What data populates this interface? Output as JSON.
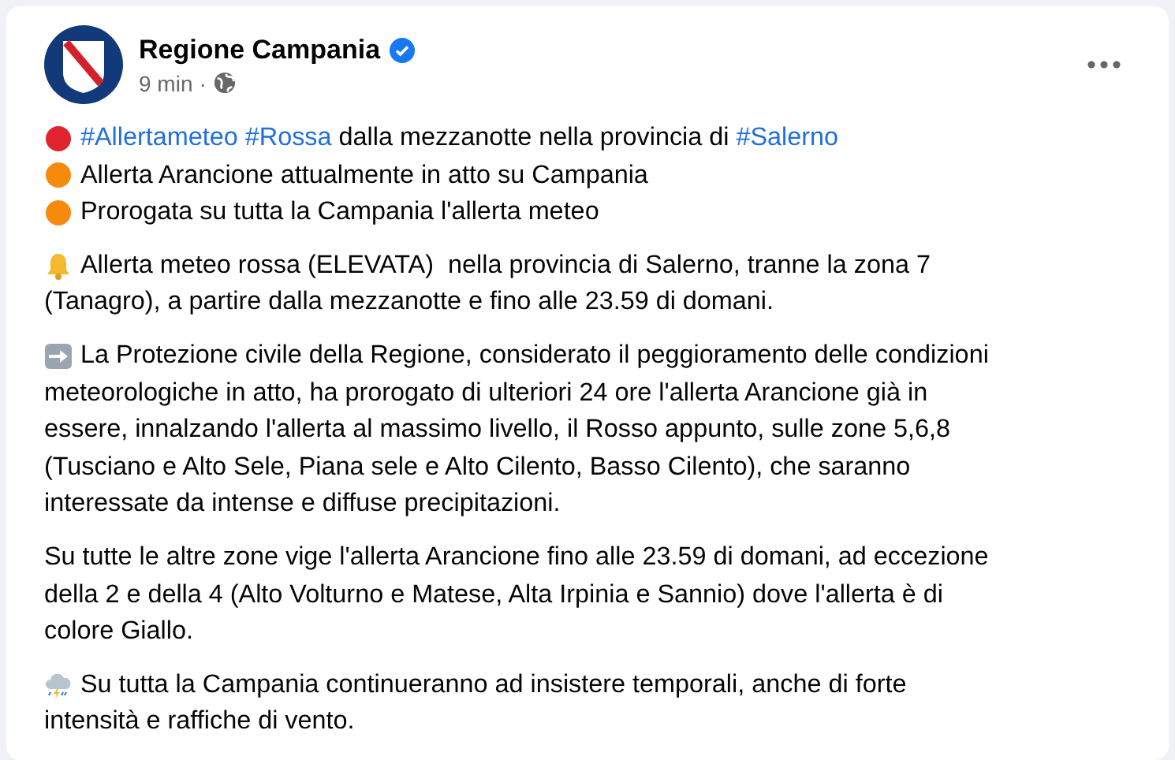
{
  "post": {
    "author": "Regione Campania",
    "verified": true,
    "time": "9 min",
    "separator": "·"
  },
  "paragraphs": [
    {
      "lines": [
        {
          "kind": "red-alert",
          "segments": [
            {
              "kind": "hashtag",
              "text": "#Allertameteo"
            },
            {
              "kind": "hashtag",
              "text": "#Rossa"
            },
            {
              "kind": "text",
              "text": " dalla mezzanotte nella provincia di "
            },
            {
              "kind": "hashtag",
              "text": "#Salerno"
            }
          ]
        },
        {
          "kind": "orange-alert",
          "segments": [
            {
              "kind": "text",
              "text": "Allerta Arancione attualmente in atto su Campania"
            }
          ]
        },
        {
          "kind": "orange-alert",
          "segments": [
            {
              "kind": "text",
              "text": "Prorogata su tutta la Campania l'allerta meteo"
            }
          ]
        }
      ]
    },
    {
      "lines": [
        {
          "kind": "bell",
          "segments": [
            {
              "kind": "text",
              "text": "Allerta meteo rossa (ELEVATA)  nella provincia di Salerno, tranne la zona 7"
            }
          ]
        },
        {
          "segments": [
            {
              "kind": "text",
              "text": "(Tanagro), a partire dalla mezzanotte e fino alle 23.59 di domani."
            }
          ]
        }
      ]
    },
    {
      "lines": [
        {
          "kind": "arrow",
          "segments": [
            {
              "kind": "text",
              "text": "La Protezione civile della Regione, considerato il peggioramento delle condizioni"
            }
          ]
        },
        {
          "segments": [
            {
              "kind": "text",
              "text": "meteorologiche in atto, ha prorogato di ulteriori 24 ore l'allerta Arancione già in"
            }
          ]
        },
        {
          "segments": [
            {
              "kind": "text",
              "text": "essere, innalzando l'allerta al massimo livello, il Rosso appunto, sulle zone 5,6,8"
            }
          ]
        },
        {
          "segments": [
            {
              "kind": "text",
              "text": "(Tusciano e Alto Sele, Piana sele e Alto Cilento, Basso Cilento), che saranno"
            }
          ]
        },
        {
          "segments": [
            {
              "kind": "text",
              "text": "interessate da intense e diffuse precipitazioni."
            }
          ]
        }
      ]
    },
    {
      "lines": [
        {
          "segments": [
            {
              "kind": "text",
              "text": "Su tutte le altre zone vige l'allerta Arancione fino alle 23.59 di domani, ad eccezione"
            }
          ]
        },
        {
          "segments": [
            {
              "kind": "text",
              "text": "della 2 e della 4 (Alto Volturno e Matese, Alta Irpinia e Sannio) dove l'allerta è di"
            }
          ]
        },
        {
          "segments": [
            {
              "kind": "text",
              "text": "colore Giallo."
            }
          ]
        }
      ]
    },
    {
      "lines": [
        {
          "kind": "weather",
          "segments": [
            {
              "kind": "text",
              "text": "Su tutta la Campania continueranno ad insistere temporali, anche di forte"
            }
          ]
        },
        {
          "segments": [
            {
              "kind": "text",
              "text": "intensità e raffiche di vento."
            }
          ]
        }
      ]
    }
  ]
}
